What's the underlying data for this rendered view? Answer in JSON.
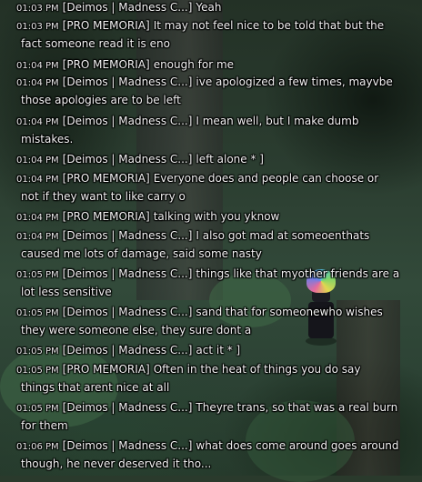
{
  "chat": {
    "messages": [
      {
        "time": "01:03 PM",
        "sender": "[Deimos | Madness C...]",
        "text": "Yeah",
        "cont": ""
      },
      {
        "time": "01:03 PM",
        "sender": "[PRO MEMORIA]",
        "text": "It may not feel nice to be told that but the",
        "cont": "fact someone read it is eno"
      },
      {
        "time": "01:04 PM",
        "sender": "[PRO MEMORIA]",
        "text": "enough for me",
        "cont": ""
      },
      {
        "time": "01:04 PM",
        "sender": "[Deimos | Madness C...]",
        "text": "ive apologized a few times, mayvbe",
        "cont": "those apologies are to be left"
      },
      {
        "time": "01:04 PM",
        "sender": "[Deimos | Madness C...]",
        "text": "I mean well, but I make dumb",
        "cont": "mistakes."
      },
      {
        "time": "01:04 PM",
        "sender": "[Deimos | Madness C...]",
        "text": "left alone * ]",
        "cont": ""
      },
      {
        "time": "01:04 PM",
        "sender": "[PRO MEMORIA]",
        "text": "Everyone does and people can choose or",
        "cont": "not if they want to like carry o"
      },
      {
        "time": "01:04 PM",
        "sender": "[PRO MEMORIA]",
        "text": "talking with you yknow",
        "cont": ""
      },
      {
        "time": "01:04 PM",
        "sender": "[Deimos | Madness C...]",
        "text": "I also got mad at someoenthats",
        "cont": "caused me lots of damage, said some nasty"
      },
      {
        "time": "01:05 PM",
        "sender": "[Deimos | Madness C...]",
        "text": "things like that myother friends are a",
        "cont": "lot less sensitive"
      },
      {
        "time": "01:05 PM",
        "sender": "[Deimos | Madness C...]",
        "text": "sand that for someonewho wishes",
        "cont": "they were someone else, they sure dont a"
      },
      {
        "time": "01:05 PM",
        "sender": "[Deimos | Madness C...]",
        "text": "act it * ]",
        "cont": ""
      },
      {
        "time": "01:05 PM",
        "sender": "[PRO MEMORIA]",
        "text": "Often in the heat of things you do say",
        "cont": "things that arent nice at all"
      },
      {
        "time": "01:05 PM",
        "sender": "[Deimos | Madness C...]",
        "text": "Theyre trans, so that was a real burn",
        "cont": "for them"
      },
      {
        "time": "01:06 PM",
        "sender": "[Deimos | Madness C...]",
        "text": "what does come around goes around",
        "cont": "though, he never deserved it tho..."
      }
    ]
  }
}
